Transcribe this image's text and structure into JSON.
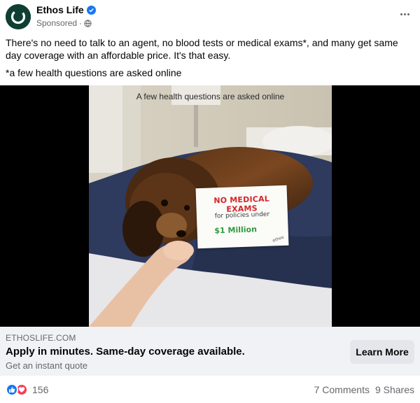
{
  "post": {
    "page_name": "Ethos Life",
    "sponsored_label": "Sponsored",
    "separator": "·",
    "body_text": "There's no need to talk to an agent, no blood tests or medical exams*, and many get same day coverage with an affordable price. It's that easy.",
    "footnote": "*a few health questions are asked online",
    "icons": {
      "avatar": "ethos-logo",
      "verified": "verified-badge-icon",
      "audience": "globe-icon",
      "menu": "more-options-icon"
    }
  },
  "media": {
    "caption": "A few health questions are asked online",
    "sign": {
      "line1": "NO MEDICAL EXAMS",
      "line2": "for policies under",
      "line3": "$1 Million",
      "mark": "ethos"
    }
  },
  "link_preview": {
    "domain": "ETHOSLIFE.COM",
    "title": "Apply in minutes. Same-day coverage available.",
    "description": "Get an instant quote",
    "cta_label": "Learn More"
  },
  "footer": {
    "reaction_count": "156",
    "comments": "7 Comments",
    "shares": "9 Shares",
    "reaction_icons": [
      "like-icon",
      "love-icon"
    ]
  },
  "colors": {
    "brand_blue": "#1877f2",
    "love_red": "#f33e58",
    "secondary_text": "#65676b",
    "link_bg": "#f0f2f5",
    "button_bg": "#e4e6eb",
    "ethos_green": "#0f3f33"
  }
}
